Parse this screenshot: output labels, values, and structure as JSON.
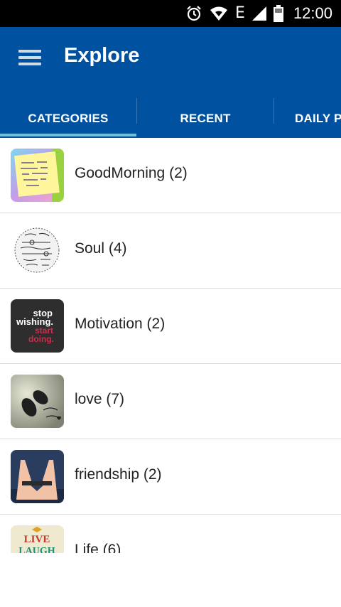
{
  "status_bar": {
    "network": "E",
    "time": "12:00"
  },
  "app_bar": {
    "title": "Explore"
  },
  "tabs": [
    {
      "label": "CATEGORIES"
    },
    {
      "label": "RECENT"
    },
    {
      "label": "DAILY P"
    }
  ],
  "categories": [
    {
      "label": "GoodMorning (2)",
      "thumb_text": ""
    },
    {
      "label": "Soul (4)",
      "thumb_text": ""
    },
    {
      "label": "Motivation (2)",
      "thumb_text": "stop wishing. start doing."
    },
    {
      "label": "love (7)",
      "thumb_text": ""
    },
    {
      "label": "friendship (2)",
      "thumb_text": ""
    },
    {
      "label": "Life (6)",
      "thumb_text": "LIVE LAUGH"
    }
  ]
}
